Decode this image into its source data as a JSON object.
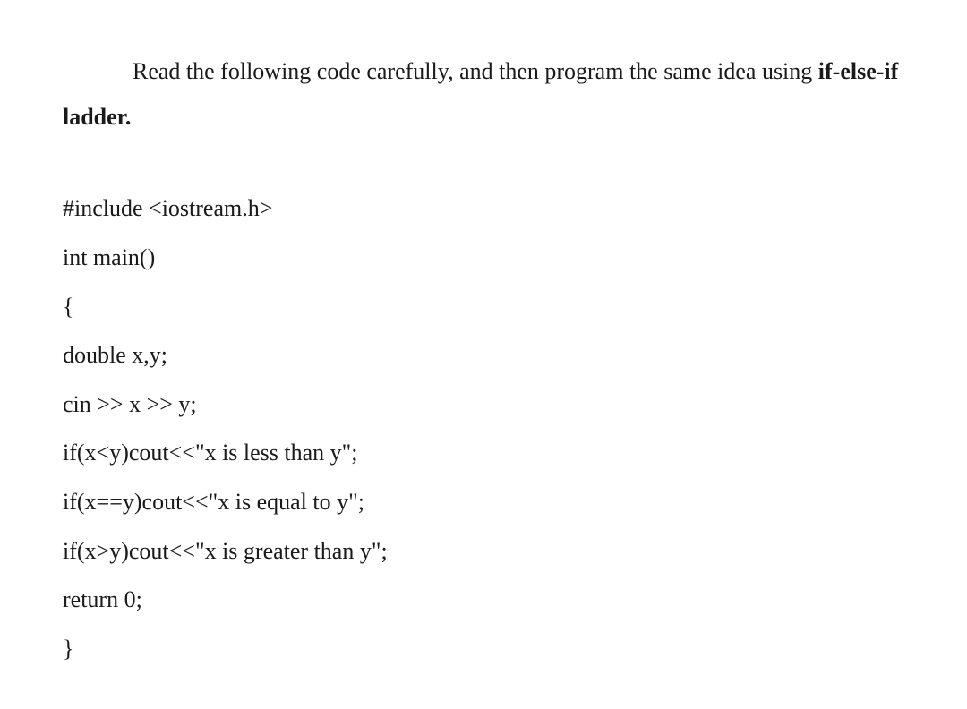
{
  "instruction": {
    "part1": "Read the following code carefully, and then program the same idea using ",
    "part2_bold": "if-else-if ladder."
  },
  "code": {
    "lines": [
      "#include <iostream.h>",
      "int main()",
      "{",
      "double x,y;",
      "cin >> x >> y;",
      "if(x<y)cout<<\"x is less than y\";",
      "if(x==y)cout<<\"x is equal to y\";",
      "if(x>y)cout<<\"x is greater than y\";",
      "return 0;",
      "}"
    ]
  }
}
